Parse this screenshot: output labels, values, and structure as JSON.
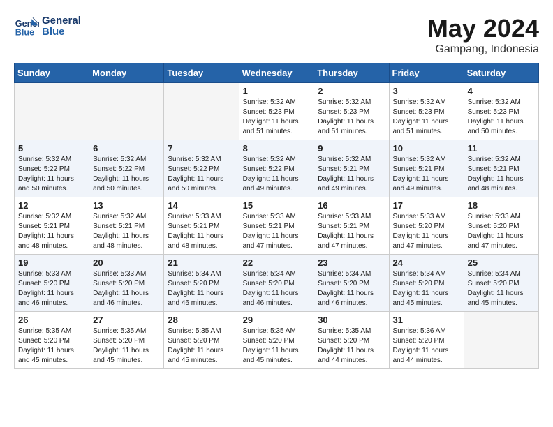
{
  "logo": {
    "line1": "General",
    "line2": "Blue"
  },
  "title": "May 2024",
  "location": "Gampang, Indonesia",
  "weekdays": [
    "Sunday",
    "Monday",
    "Tuesday",
    "Wednesday",
    "Thursday",
    "Friday",
    "Saturday"
  ],
  "weeks": [
    [
      {
        "day": "",
        "info": ""
      },
      {
        "day": "",
        "info": ""
      },
      {
        "day": "",
        "info": ""
      },
      {
        "day": "1",
        "info": "Sunrise: 5:32 AM\nSunset: 5:23 PM\nDaylight: 11 hours\nand 51 minutes."
      },
      {
        "day": "2",
        "info": "Sunrise: 5:32 AM\nSunset: 5:23 PM\nDaylight: 11 hours\nand 51 minutes."
      },
      {
        "day": "3",
        "info": "Sunrise: 5:32 AM\nSunset: 5:23 PM\nDaylight: 11 hours\nand 51 minutes."
      },
      {
        "day": "4",
        "info": "Sunrise: 5:32 AM\nSunset: 5:23 PM\nDaylight: 11 hours\nand 50 minutes."
      }
    ],
    [
      {
        "day": "5",
        "info": "Sunrise: 5:32 AM\nSunset: 5:22 PM\nDaylight: 11 hours\nand 50 minutes."
      },
      {
        "day": "6",
        "info": "Sunrise: 5:32 AM\nSunset: 5:22 PM\nDaylight: 11 hours\nand 50 minutes."
      },
      {
        "day": "7",
        "info": "Sunrise: 5:32 AM\nSunset: 5:22 PM\nDaylight: 11 hours\nand 50 minutes."
      },
      {
        "day": "8",
        "info": "Sunrise: 5:32 AM\nSunset: 5:22 PM\nDaylight: 11 hours\nand 49 minutes."
      },
      {
        "day": "9",
        "info": "Sunrise: 5:32 AM\nSunset: 5:21 PM\nDaylight: 11 hours\nand 49 minutes."
      },
      {
        "day": "10",
        "info": "Sunrise: 5:32 AM\nSunset: 5:21 PM\nDaylight: 11 hours\nand 49 minutes."
      },
      {
        "day": "11",
        "info": "Sunrise: 5:32 AM\nSunset: 5:21 PM\nDaylight: 11 hours\nand 48 minutes."
      }
    ],
    [
      {
        "day": "12",
        "info": "Sunrise: 5:32 AM\nSunset: 5:21 PM\nDaylight: 11 hours\nand 48 minutes."
      },
      {
        "day": "13",
        "info": "Sunrise: 5:32 AM\nSunset: 5:21 PM\nDaylight: 11 hours\nand 48 minutes."
      },
      {
        "day": "14",
        "info": "Sunrise: 5:33 AM\nSunset: 5:21 PM\nDaylight: 11 hours\nand 48 minutes."
      },
      {
        "day": "15",
        "info": "Sunrise: 5:33 AM\nSunset: 5:21 PM\nDaylight: 11 hours\nand 47 minutes."
      },
      {
        "day": "16",
        "info": "Sunrise: 5:33 AM\nSunset: 5:21 PM\nDaylight: 11 hours\nand 47 minutes."
      },
      {
        "day": "17",
        "info": "Sunrise: 5:33 AM\nSunset: 5:20 PM\nDaylight: 11 hours\nand 47 minutes."
      },
      {
        "day": "18",
        "info": "Sunrise: 5:33 AM\nSunset: 5:20 PM\nDaylight: 11 hours\nand 47 minutes."
      }
    ],
    [
      {
        "day": "19",
        "info": "Sunrise: 5:33 AM\nSunset: 5:20 PM\nDaylight: 11 hours\nand 46 minutes."
      },
      {
        "day": "20",
        "info": "Sunrise: 5:33 AM\nSunset: 5:20 PM\nDaylight: 11 hours\nand 46 minutes."
      },
      {
        "day": "21",
        "info": "Sunrise: 5:34 AM\nSunset: 5:20 PM\nDaylight: 11 hours\nand 46 minutes."
      },
      {
        "day": "22",
        "info": "Sunrise: 5:34 AM\nSunset: 5:20 PM\nDaylight: 11 hours\nand 46 minutes."
      },
      {
        "day": "23",
        "info": "Sunrise: 5:34 AM\nSunset: 5:20 PM\nDaylight: 11 hours\nand 46 minutes."
      },
      {
        "day": "24",
        "info": "Sunrise: 5:34 AM\nSunset: 5:20 PM\nDaylight: 11 hours\nand 45 minutes."
      },
      {
        "day": "25",
        "info": "Sunrise: 5:34 AM\nSunset: 5:20 PM\nDaylight: 11 hours\nand 45 minutes."
      }
    ],
    [
      {
        "day": "26",
        "info": "Sunrise: 5:35 AM\nSunset: 5:20 PM\nDaylight: 11 hours\nand 45 minutes."
      },
      {
        "day": "27",
        "info": "Sunrise: 5:35 AM\nSunset: 5:20 PM\nDaylight: 11 hours\nand 45 minutes."
      },
      {
        "day": "28",
        "info": "Sunrise: 5:35 AM\nSunset: 5:20 PM\nDaylight: 11 hours\nand 45 minutes."
      },
      {
        "day": "29",
        "info": "Sunrise: 5:35 AM\nSunset: 5:20 PM\nDaylight: 11 hours\nand 45 minutes."
      },
      {
        "day": "30",
        "info": "Sunrise: 5:35 AM\nSunset: 5:20 PM\nDaylight: 11 hours\nand 44 minutes."
      },
      {
        "day": "31",
        "info": "Sunrise: 5:36 AM\nSunset: 5:20 PM\nDaylight: 11 hours\nand 44 minutes."
      },
      {
        "day": "",
        "info": ""
      }
    ]
  ]
}
